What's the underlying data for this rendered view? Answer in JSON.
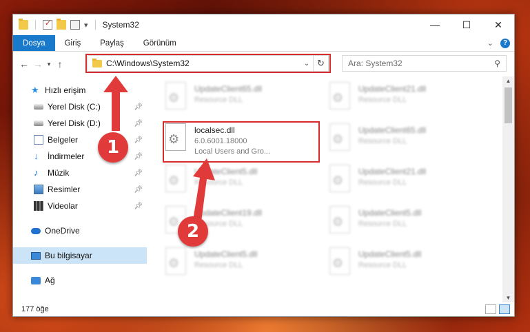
{
  "window": {
    "title": "System32",
    "controls": {
      "minimize": "—",
      "maximize": "☐",
      "close": "✕"
    }
  },
  "ribbon": {
    "tabs": [
      "Dosya",
      "Giriş",
      "Paylaş",
      "Görünüm"
    ],
    "help": "?"
  },
  "address": {
    "path": "C:\\Windows\\System32",
    "search_placeholder": "Ara: System32"
  },
  "nav": {
    "quick_access": "Hızlı erişim",
    "pinned": [
      {
        "label": "Yerel Disk (C:)",
        "icon": "disk-icon"
      },
      {
        "label": "Yerel Disk (D:)",
        "icon": "disk-icon"
      },
      {
        "label": "Belgeler",
        "icon": "documents-icon"
      },
      {
        "label": "İndirmeler",
        "icon": "downloads-icon"
      },
      {
        "label": "Müzik",
        "icon": "music-icon"
      },
      {
        "label": "Resimler",
        "icon": "pictures-icon"
      },
      {
        "label": "Videolar",
        "icon": "videos-icon"
      }
    ],
    "onedrive": "OneDrive",
    "this_pc": "Bu bilgisayar",
    "network": "Ağ"
  },
  "files": {
    "highlighted": {
      "name": "localsec.dll",
      "version": "6.0.6001.18000",
      "description": "Local Users and Gro..."
    },
    "blurred_left": [
      {
        "name": "UpdateClient65.dll",
        "type": "Resource DLL"
      },
      {
        "name": "UpdateClient5.dll",
        "type": "Resource DLL"
      },
      {
        "name": "UpdateClient19.dll",
        "type": "Resource DLL"
      },
      {
        "name": "UpdateClient5.dll",
        "type": "Resource DLL"
      }
    ],
    "blurred_right": [
      {
        "name": "UpdateClient21.dll",
        "type": "Resource DLL"
      },
      {
        "name": "UpdateClient65.dll",
        "type": "Resource DLL"
      },
      {
        "name": "UpdateClient21.dll",
        "type": "Resource DLL"
      },
      {
        "name": "UpdateClient5.dll",
        "type": "Resource DLL"
      },
      {
        "name": "UpdateClient5.dll",
        "type": "Resource DLL"
      }
    ]
  },
  "status": {
    "count": "177 öğe"
  },
  "annotations": {
    "step1": "1",
    "step2": "2",
    "color": "#e03a3a"
  }
}
